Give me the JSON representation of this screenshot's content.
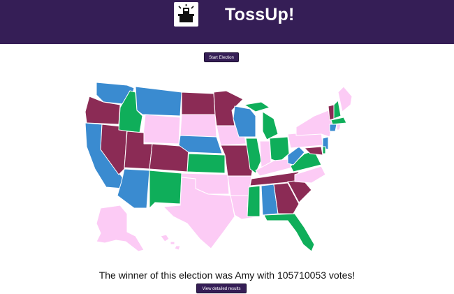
{
  "header": {
    "title": "TossUp!",
    "logo_icon": "ballot-box-icon"
  },
  "controls": {
    "start_label": "Start Election",
    "details_label": "View detailed results"
  },
  "result": {
    "winner_text": "The winner of this election was Amy with 105710053 votes!"
  },
  "colors": {
    "header_bg": "#351e56",
    "blue": "#3a8bd0",
    "maroon": "#8b2b55",
    "green": "#0fae5a",
    "pink": "#fccbf5"
  }
}
